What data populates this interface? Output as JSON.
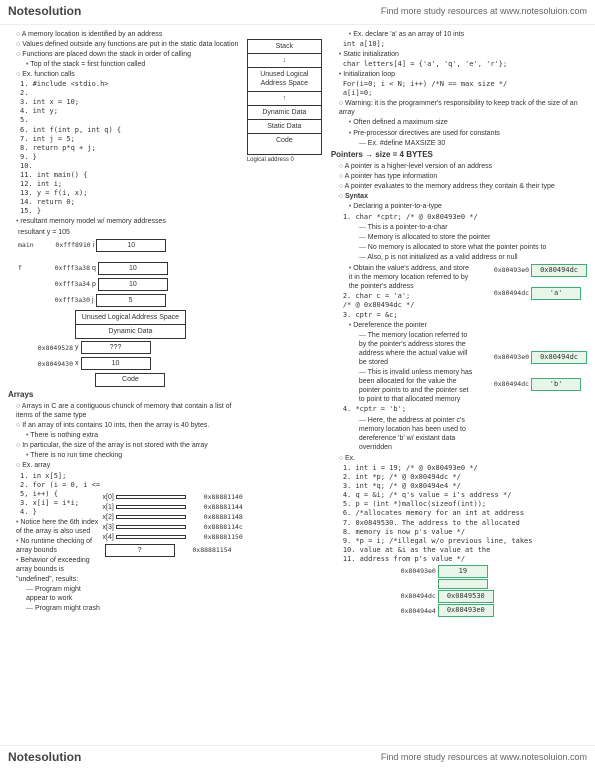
{
  "header": {
    "logo_text": "Notesolution",
    "resource_text": "Find more study resources at www.notesoluion.com"
  },
  "col1": {
    "intro": [
      "A memory location is identified by an address",
      "Values defined outside any functions are put in the static data location",
      "Functions are placed down the stack in order of calling"
    ],
    "stack_note": "Top of the stack = first function called",
    "func_calls_title": "Ex. function calls",
    "code_lines": [
      "1. #include <stdio.h>",
      "2.",
      "3. int x = 10;",
      "4. int y;",
      "5.",
      "6. int f(int p, int q) {",
      "7.   int j = 5;",
      "8.   return p*q + j;",
      "9. }",
      "10.",
      "11. int main() {",
      "12.   int i;",
      "13.   y = f(i, x);",
      "14.   return 0;",
      "15. }"
    ],
    "result_title": "resultant memory model w/ memory addresses",
    "result_formula": "resultant y = 105",
    "mem_rows": [
      {
        "lbl_l": "main",
        "addr": "0xfff8910",
        "var": "i",
        "val": "10"
      },
      {
        "lbl_l": "f",
        "addr": "0xfff3a38",
        "var": "q",
        "val": "10"
      },
      {
        "lbl_l": "",
        "addr": "0xfff3a34",
        "var": "p",
        "val": "10"
      },
      {
        "lbl_l": "",
        "addr": "0xfff3a30",
        "var": "j",
        "val": "5"
      }
    ],
    "diagram_sections": [
      "Unused Logical Address Space",
      "Dynamic Data"
    ],
    "mem_rows2": [
      {
        "addr": "0x8049528",
        "var": "y",
        "val": "???"
      },
      {
        "addr": "0x8049430",
        "var": "x",
        "val": "10"
      }
    ],
    "code_label": "Code",
    "arrays_title": "Arrays",
    "arrays_points": [
      "Arrays in C are a contiguous chunck of memory that contain a list of items of the same type",
      "If an array of ints contains 10 ints, then the array is 40 bytes.",
      "There is nothing extra",
      "In particular, the size of the array is not stored with the array",
      "There is no run time checking"
    ],
    "ex_array_title": "Ex. array",
    "ex_array_code": [
      "1. in x[5];",
      "2. for (i = 0, i <= 5, i++) {",
      "3.   x[i] = i*i;",
      "4. }"
    ],
    "notice_title": "Notice here the 6th index of the array is also used",
    "notice_points": [
      "No runtime checking of array bounds",
      "Behavior of exceeding array bounds is \"undefined\", results:",
      "Program might appear to work",
      "Program might crash"
    ],
    "array_mem": [
      {
        "var": "x[0]",
        "addr": "0x88881140"
      },
      {
        "var": "x[1]",
        "addr": "0x88881144"
      },
      {
        "var": "x[2]",
        "addr": "0x88881148"
      },
      {
        "var": "x[3]",
        "addr": "0x8888114c"
      },
      {
        "var": "x[4]",
        "addr": "0x88881150"
      },
      {
        "var": "?",
        "addr": "0x88881154"
      }
    ]
  },
  "col_mid": {
    "diagram1": [
      "Stack",
      "↓",
      "Unused Logical Address Space",
      "↑",
      "Dynamic Data",
      "Static Data",
      "Code"
    ],
    "logical_addr": "Logical address 0"
  },
  "col2": {
    "declare_ex": "Ex. declare 'a' as an array of 10 ints",
    "declare_code": "int a[10];",
    "static_init_title": "Static initialization",
    "static_init_code": "char letters[4] = {'a', 'q', 'e', 'r'};",
    "init_loop_title": "Initialization loop",
    "init_loop_code": [
      "For(i=0; i < N; i++) /*N == max size */",
      "a[i]=0;"
    ],
    "warning": "Warning: it is the programmer's responsibility to keep track of the size of an array",
    "warning_points": [
      "Often defined a maximum size",
      "Pre-processor directives are used for constants",
      "Ex. #define MAXSIZE 30"
    ],
    "pointers_title": "Pointers → size = 4 BYTES",
    "pointers_points": [
      "A pointer is a higher-level version of an address",
      "A pointer has type information",
      "A pointer evaluates to the memory address they contain & their type"
    ],
    "syntax_title": "Syntax",
    "declare_ptr_title": "Declaring a pointer-to-a-type",
    "declare_ptr_code": "1. char *cptr; /* @ 0x80493e0 */",
    "declare_ptr_points": [
      "This is a pointer-to-a-char",
      "Memory is allocated to store the pointer",
      "No memory is allocated to store what the pointer points to",
      "Also, p is not initialized as a valid address or null"
    ],
    "obtain_title": "Obtain the value's address, and store it in the memory location referred to by the pointer's address",
    "obtain_code": [
      "2. char c = 'a';",
      "/* @ 0x80494dc */",
      "3. cptr = &c;"
    ],
    "deref_title": "Dereference the pointer",
    "deref_points": [
      "The memory location referred to by the pointer's address stores the address where the actual value will be stored",
      "This is invalid unless memory has been allocated for the value the pointer points to and the pointer set to point to that allocated memory"
    ],
    "deref_code": "4. *cptr = 'b';",
    "deref_note": "Here, the address at pointer c's memory location has been used to dereference 'b' w/ existant data overridden",
    "mem_boxes1": [
      {
        "addr": "0x80493e0",
        "val": "0x80494dc"
      },
      {
        "addr": "0x80494dc",
        "val": "'a'"
      }
    ],
    "mem_boxes2": [
      {
        "addr": "0x80493e0",
        "val": "0x80494dc"
      },
      {
        "addr": "0x80494dc",
        "val": "'b'"
      }
    ],
    "ex2_title": "Ex.",
    "ex2_code": [
      "1. int i = 19; /* @ 0x80493e0 */",
      "2. int *p; /* @ 0x80494dc */",
      "3. int *q; /* @ 0x80494e4 */",
      "4. q = &i; /* q's value = i's address */",
      "5. p = (int *)malloc(sizeof(int));",
      "6.   /*allocates memory for an int at address",
      "7.   0x0849530. The address to the allocated",
      "8.   memory is now p's value */",
      "9. *p = i; /*illegal w/o previous line, takes",
      "10.   value at &i as the value at the",
      "11.   address from p's value */"
    ],
    "ex2_mem": [
      {
        "addr": "0x80493e0",
        "val": "19"
      },
      {
        "addr": "",
        "val": ""
      },
      {
        "addr": "0x80494dc",
        "val": "0x0849530"
      },
      {
        "addr": "0x80494e4",
        "val": "0x80493e0"
      }
    ]
  }
}
